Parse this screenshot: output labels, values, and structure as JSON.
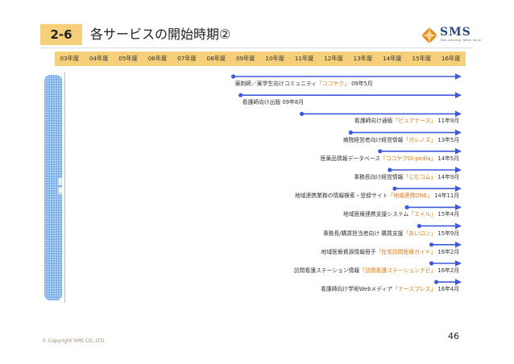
{
  "header": {
    "section_number": "2-6",
    "title": "各サービスの開始時期②"
  },
  "logo": {
    "text": "SMS",
    "subtext": "Best matching. Better future",
    "colors": {
      "mark": "#e08a1e",
      "text": "#2b4b80"
    }
  },
  "timeline": {
    "years": [
      "03年度",
      "04年度",
      "05年度",
      "06年度",
      "07年度",
      "08年度",
      "09年度",
      "10年度",
      "11年度",
      "12年度",
      "13年度",
      "14年度",
      "15年度",
      "16年度"
    ],
    "category_label": "医療",
    "colors": {
      "year_bar": "#f6cf7a",
      "arrow": "#3b5bdb",
      "category_bar": "#6aa6e6",
      "highlight": "#e07a14"
    },
    "services": [
      {
        "pre": "薬剤師／薬学生向けコミュニティ",
        "hl": "「ココヤク」",
        "post": "",
        "date": "09年5月"
      },
      {
        "pre": "看護師向け出版",
        "hl": "",
        "post": "",
        "date": "09年8月"
      },
      {
        "pre": "看護師向け通販",
        "hl": "「ピュアナース」",
        "post": "",
        "date": "11年9月"
      },
      {
        "pre": "病院経営者向け経営情報",
        "hl": "「ガレノス」",
        "post": "",
        "date": "13年5月"
      },
      {
        "pre": "医薬品情報データベース",
        "hl": "「ココヤクDi-pedia」",
        "post": "",
        "date": "14年5月"
      },
      {
        "pre": "事務長向け経営情報",
        "hl": "「じむコム」",
        "post": "",
        "date": "14年9月"
      },
      {
        "pre": "地域連携業務の情報検索・登録サイト",
        "hl": "「地域連携ONE」",
        "post": "",
        "date": "14年11月"
      },
      {
        "pre": "地域医療連携支援システム",
        "hl": "「エイル」",
        "post": "",
        "date": "15年4月"
      },
      {
        "pre": "事務長/購買担当者向け 購買支援",
        "hl": "「あいロン」",
        "post": "",
        "date": "15年9月"
      },
      {
        "pre": "地域医療資源情報冊子",
        "hl": "「在宅訪問医療ガイド」",
        "post": "",
        "date": "16年2月"
      },
      {
        "pre": "訪問看護ステーション情報",
        "hl": "「訪問看護ステーションナビ」",
        "post": "",
        "date": "16年2月"
      },
      {
        "pre": "看護師向け学術Webメディア",
        "hl": "「ナースプレス」",
        "post": "",
        "date": "16年4月"
      }
    ]
  },
  "footer": {
    "copyright": "© Copyright SMS CO.,LTD.",
    "page_number": "46"
  }
}
